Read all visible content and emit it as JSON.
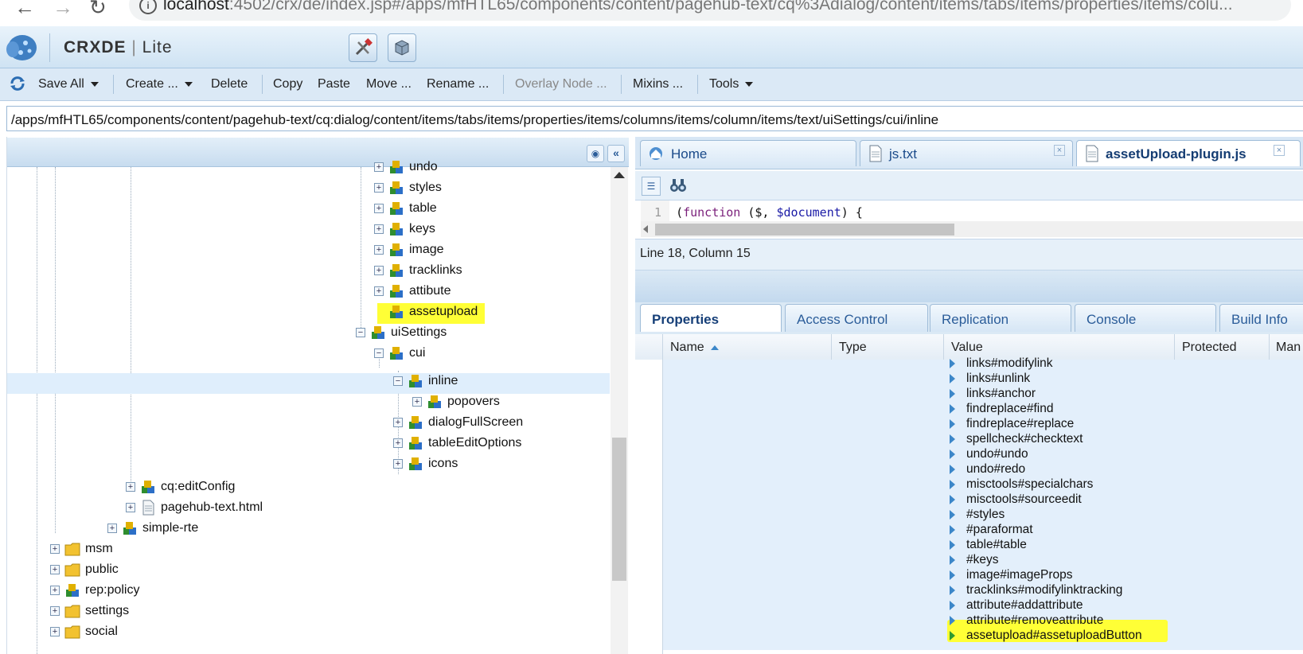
{
  "browser": {
    "url_host": "localhost",
    "url_rest": ":4502/crx/de/index.jsp#/apps/mfHTL65/components/content/pagehub-text/cq%3Adialog/content/items/tabs/items/properties/items/colu..."
  },
  "app": {
    "title_bold": "CRXDE",
    "title_rest": "Lite"
  },
  "toolbar": {
    "save_all": "Save All",
    "create": "Create ...",
    "delete": "Delete",
    "copy": "Copy",
    "paste": "Paste",
    "move": "Move ...",
    "rename": "Rename ...",
    "overlay_node": "Overlay Node ...",
    "mixins": "Mixins ...",
    "tools": "Tools"
  },
  "path": "/apps/mfHTL65/components/content/pagehub-text/cq:dialog/content/items/tabs/items/properties/items/columns/items/column/items/text/uiSettings/cui/inline",
  "tree": {
    "undo": "undo",
    "styles": "styles",
    "table": "table",
    "keys": "keys",
    "image": "image",
    "tracklinks": "tracklinks",
    "attibute": "attibute",
    "assetupload": "assetupload",
    "uiSettings": "uiSettings",
    "cui": "cui",
    "inline": "inline",
    "popovers": "popovers",
    "dialogFullScreen": "dialogFullScreen",
    "tableEditOptions": "tableEditOptions",
    "icons": "icons",
    "cq_editConfig": "cq:editConfig",
    "pagehub_html": "pagehub-text.html",
    "simple_rte": "simple-rte",
    "msm": "msm",
    "public": "public",
    "rep_policy": "rep:policy",
    "settings": "settings",
    "social": "social"
  },
  "editor_tabs": {
    "home": "Home",
    "js_txt": "js.txt",
    "asset_plugin": "assetUpload-plugin.js"
  },
  "editor": {
    "line_no": "1",
    "code_kw": "function",
    "code_pre": "(",
    "code_mid": " ($, ",
    "code_var": "$document",
    "code_post": ") {",
    "status": "Line 18, Column 15"
  },
  "prop_tabs": {
    "properties": "Properties",
    "access_control": "Access Control",
    "replication": "Replication",
    "console": "Console",
    "build_info": "Build Info"
  },
  "grid_cols": {
    "name": "Name",
    "type": "Type",
    "value": "Value",
    "protected": "Protected",
    "mandatory": "Man"
  },
  "values": [
    "links#modifylink",
    "links#unlink",
    "links#anchor",
    "findreplace#find",
    "findreplace#replace",
    "spellcheck#checktext",
    "undo#undo",
    "undo#redo",
    "misctools#specialchars",
    "misctools#sourceedit",
    "#styles",
    "#paraformat",
    "table#table",
    "#keys",
    "image#imageProps",
    "tracklinks#modifylinktracking",
    "attribute#addattribute",
    "attribute#removeattribute",
    "assetupload#assetuploadButton"
  ],
  "colors": {
    "highlight": "#ffff36",
    "selection": "#dfeefc",
    "accent": "#1a4a8a"
  }
}
